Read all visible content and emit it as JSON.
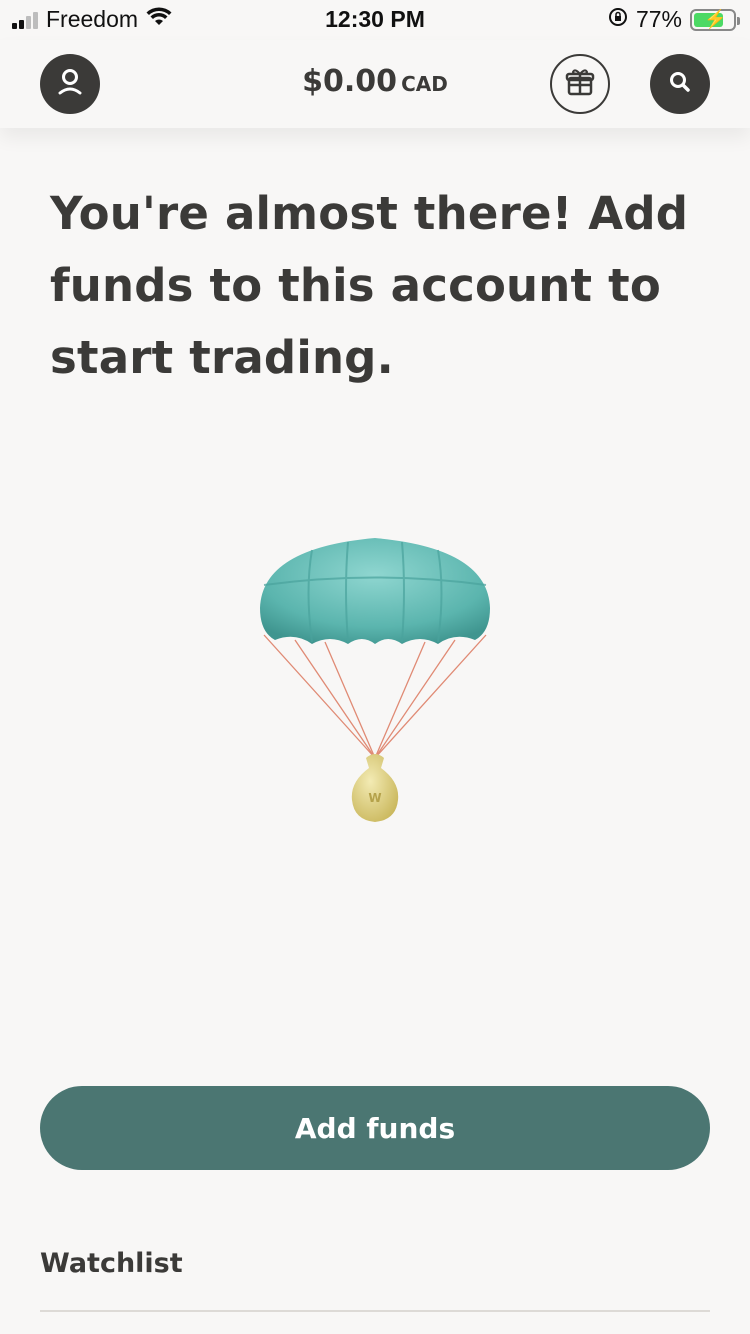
{
  "status_bar": {
    "carrier": "Freedom",
    "time": "12:30 PM",
    "battery_percent": "77%",
    "battery_level": 0.77,
    "battery_color": "#4cd964"
  },
  "header": {
    "balance_amount": "$0.00",
    "balance_currency": "CAD",
    "icons": [
      "profile-icon",
      "gift-icon",
      "search-icon"
    ]
  },
  "main": {
    "headline": "You're almost there! Add funds to this account to start trading.",
    "illustration": "parachute-money-bag",
    "add_funds_label": "Add funds"
  },
  "watchlist": {
    "title": "Watchlist"
  },
  "colors": {
    "background": "#f8f7f6",
    "text": "#3b3a38",
    "accent": "#4b7672",
    "parachute": "#6cc3bd",
    "money_bag": "#e3d58a"
  }
}
